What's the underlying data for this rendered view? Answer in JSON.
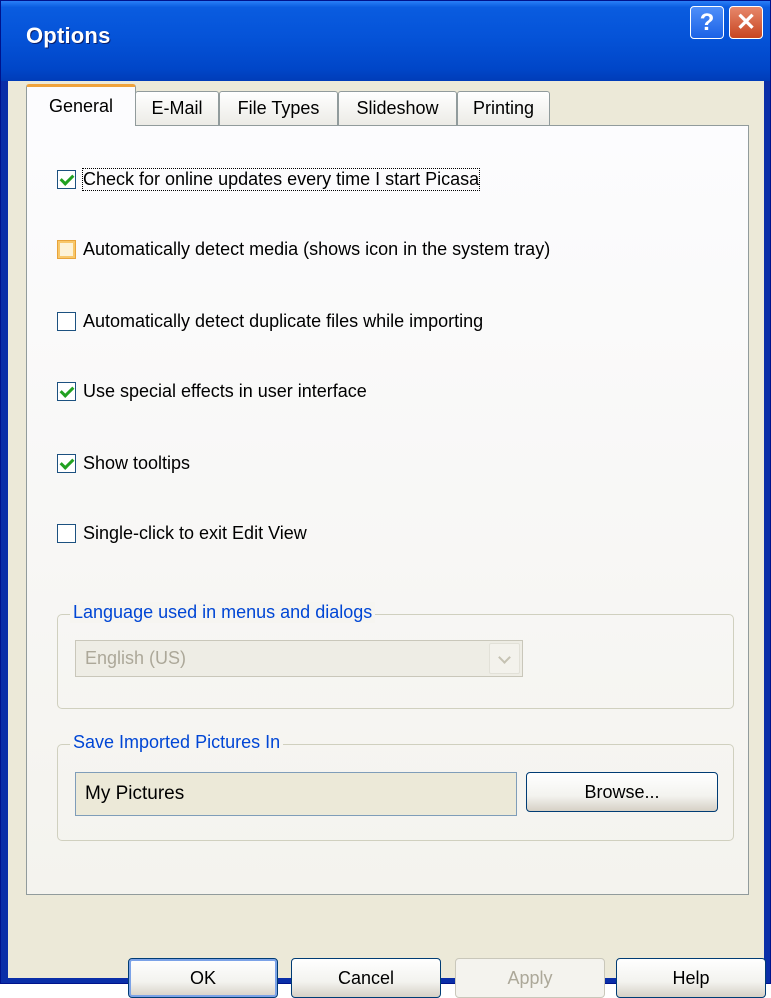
{
  "window": {
    "title": "Options",
    "help_glyph": "?",
    "close_glyph": "✕"
  },
  "tabs": [
    {
      "label": "General",
      "active": true
    },
    {
      "label": "E-Mail",
      "active": false
    },
    {
      "label": "File Types",
      "active": false
    },
    {
      "label": "Slideshow",
      "active": false
    },
    {
      "label": "Printing",
      "active": false
    }
  ],
  "options": [
    {
      "label": "Check for online updates every time I start Picasa",
      "checked": true
    },
    {
      "label": "Automatically detect media (shows icon in the system tray)",
      "checked": false
    },
    {
      "label": "Automatically detect duplicate files while importing",
      "checked": false
    },
    {
      "label": "Use special effects in user interface",
      "checked": true
    },
    {
      "label": "Show tooltips",
      "checked": true
    },
    {
      "label": "Single-click to exit Edit View",
      "checked": false
    }
  ],
  "language_group": {
    "title": "Language used in menus and dialogs",
    "selected": "English (US)"
  },
  "import_group": {
    "title": "Save Imported Pictures In",
    "path": "My Pictures",
    "browse_label": "Browse..."
  },
  "buttons": {
    "ok": "OK",
    "cancel": "Cancel",
    "apply": "Apply",
    "help": "Help"
  },
  "colors": {
    "titlebar": "#0553d8",
    "group_title": "#0046d5",
    "checkmark": "#21a121",
    "active_tab_accent": "#f0a33c"
  }
}
